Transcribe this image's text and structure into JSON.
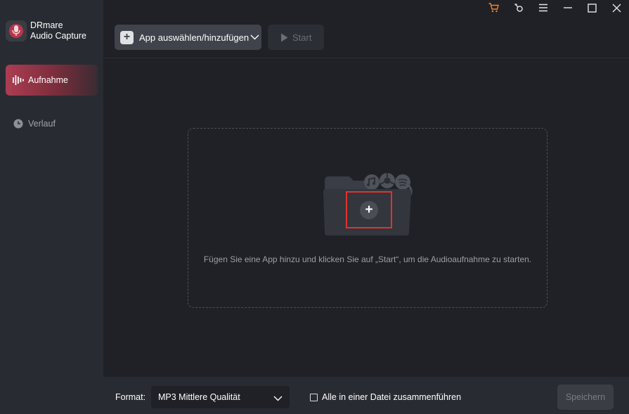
{
  "brand": {
    "line1": "DRmare",
    "line2": "Audio Capture"
  },
  "sidebar": {
    "items": [
      {
        "label": "Aufnahme",
        "icon": "waveform-icon",
        "active": true
      },
      {
        "label": "Verlauf",
        "icon": "clock-icon",
        "active": false
      }
    ]
  },
  "titlebar": {
    "icons": [
      "cart-icon",
      "key-icon",
      "menu-icon",
      "minimize-icon",
      "maximize-icon",
      "close-icon"
    ],
    "cart_color": "#f5822a"
  },
  "toolbar": {
    "add_label": "App auswählen/hinzufügen",
    "start_label": "Start"
  },
  "dropzone": {
    "hint": "Fügen Sie eine App hinzu und klicken Sie auf „Start“, um die Audioaufnahme zu starten.",
    "highlight_color": "#e0322e"
  },
  "bottom": {
    "format_label": "Format:",
    "format_value": "MP3 Mittlere Qualität",
    "merge_label": "Alle in einer Datei zusammenführen",
    "merge_checked": false,
    "save_label": "Speichern"
  },
  "colors": {
    "accent": "#ad3d52",
    "background": "#1f2127",
    "sidebar": "#292b32"
  }
}
